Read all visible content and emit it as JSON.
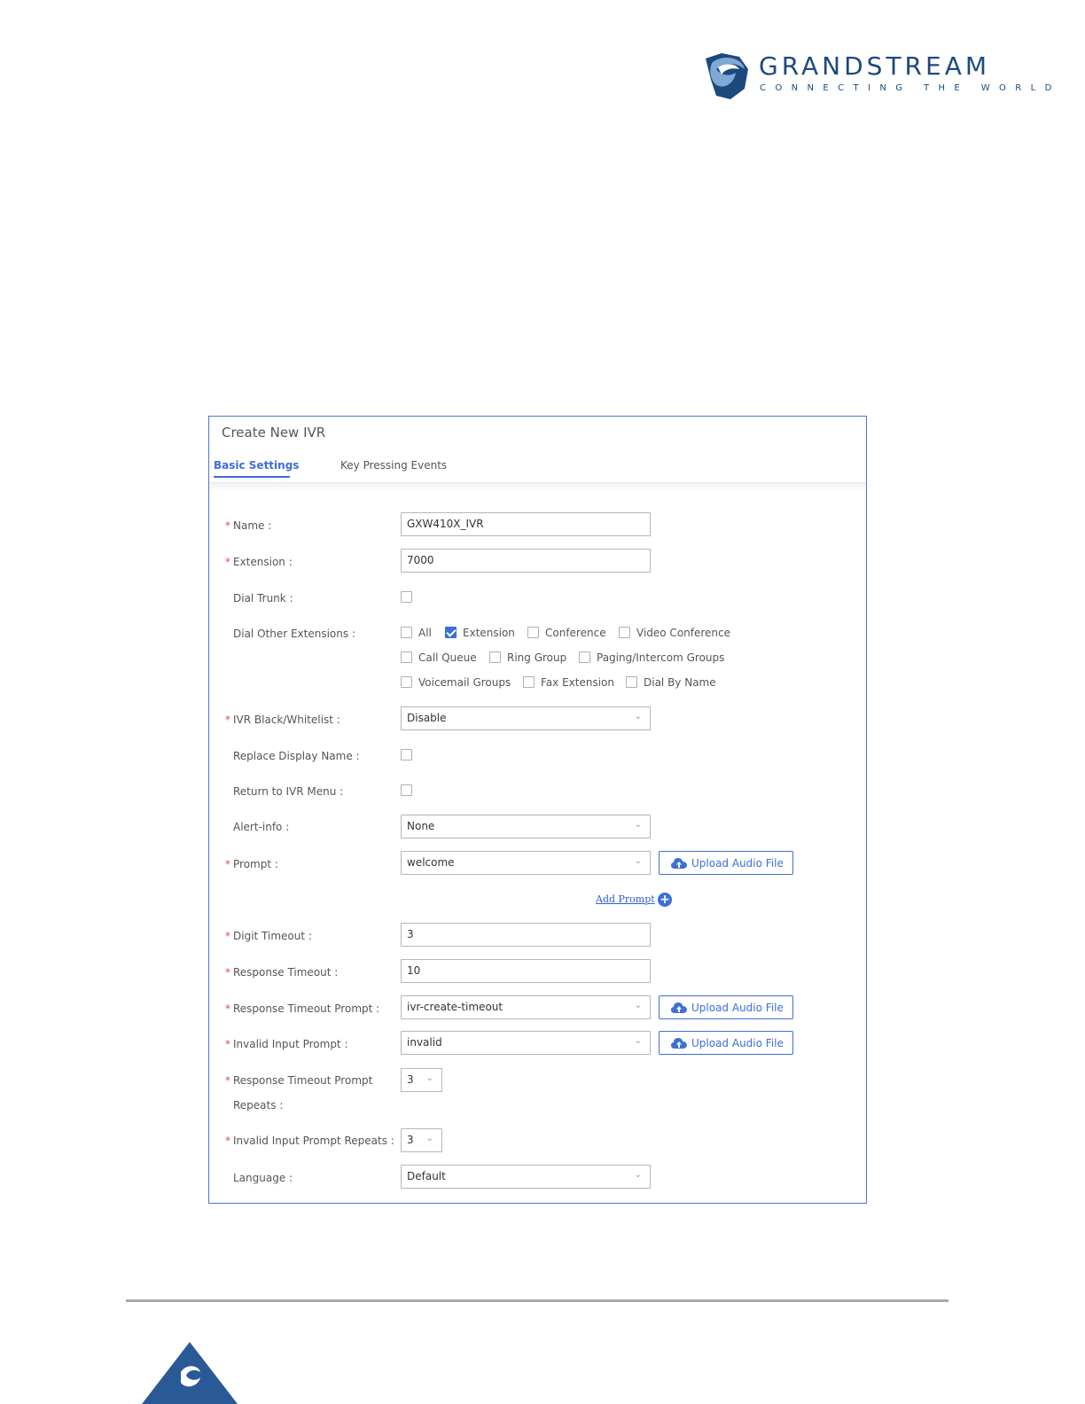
{
  "brand": {
    "name": "GRANDSTREAM",
    "tagline": "CONNECTING THE WORLD"
  },
  "panel": {
    "title": "Create New IVR",
    "tabs": [
      {
        "label": "Basic Settings",
        "active": true
      },
      {
        "label": "Key Pressing Events",
        "active": false
      }
    ]
  },
  "form": {
    "name": {
      "label": "Name",
      "value": "GXW410X_IVR",
      "required": true
    },
    "extension": {
      "label": "Extension",
      "value": "7000",
      "required": true
    },
    "dial_trunk": {
      "label": "Dial Trunk",
      "checked": false
    },
    "dial_other_extensions": {
      "label": "Dial Other Extensions",
      "options": [
        {
          "label": "All",
          "checked": false
        },
        {
          "label": "Extension",
          "checked": true
        },
        {
          "label": "Conference",
          "checked": false
        },
        {
          "label": "Video Conference",
          "checked": false
        },
        {
          "label": "Call Queue",
          "checked": false
        },
        {
          "label": "Ring Group",
          "checked": false
        },
        {
          "label": "Paging/Intercom Groups",
          "checked": false
        },
        {
          "label": "Voicemail Groups",
          "checked": false
        },
        {
          "label": "Fax Extension",
          "checked": false
        },
        {
          "label": "Dial By Name",
          "checked": false
        }
      ]
    },
    "ivr_black_whitelist": {
      "label": "IVR Black/Whitelist",
      "value": "Disable",
      "required": true
    },
    "replace_display_name": {
      "label": "Replace Display Name",
      "checked": false
    },
    "return_to_ivr_menu": {
      "label": "Return to IVR Menu",
      "checked": false
    },
    "alert_info": {
      "label": "Alert-info",
      "value": "None"
    },
    "prompt": {
      "label": "Prompt",
      "value": "welcome",
      "required": true
    },
    "upload_label": "Upload Audio File",
    "add_prompt": "Add Prompt",
    "digit_timeout": {
      "label": "Digit Timeout",
      "value": "3",
      "required": true
    },
    "response_timeout": {
      "label": "Response Timeout",
      "value": "10",
      "required": true
    },
    "response_timeout_prompt": {
      "label": "Response Timeout Prompt",
      "value": "ivr-create-timeout",
      "required": true
    },
    "invalid_input_prompt": {
      "label": "Invalid Input Prompt",
      "value": "invalid",
      "required": true
    },
    "response_timeout_prompt_repeats": {
      "label_line1": "Response Timeout Prompt",
      "label_line2": "Repeats",
      "value": "3",
      "required": true
    },
    "invalid_input_prompt_repeats": {
      "label": "Invalid Input Prompt Repeats",
      "value": "3",
      "required": true
    },
    "language": {
      "label": "Language",
      "value": "Default"
    }
  },
  "colors": {
    "accent": "#3d6fd6",
    "brand": "#1c4a7d",
    "required": "#e54b4b",
    "panel_border": "#4a7ad1"
  }
}
